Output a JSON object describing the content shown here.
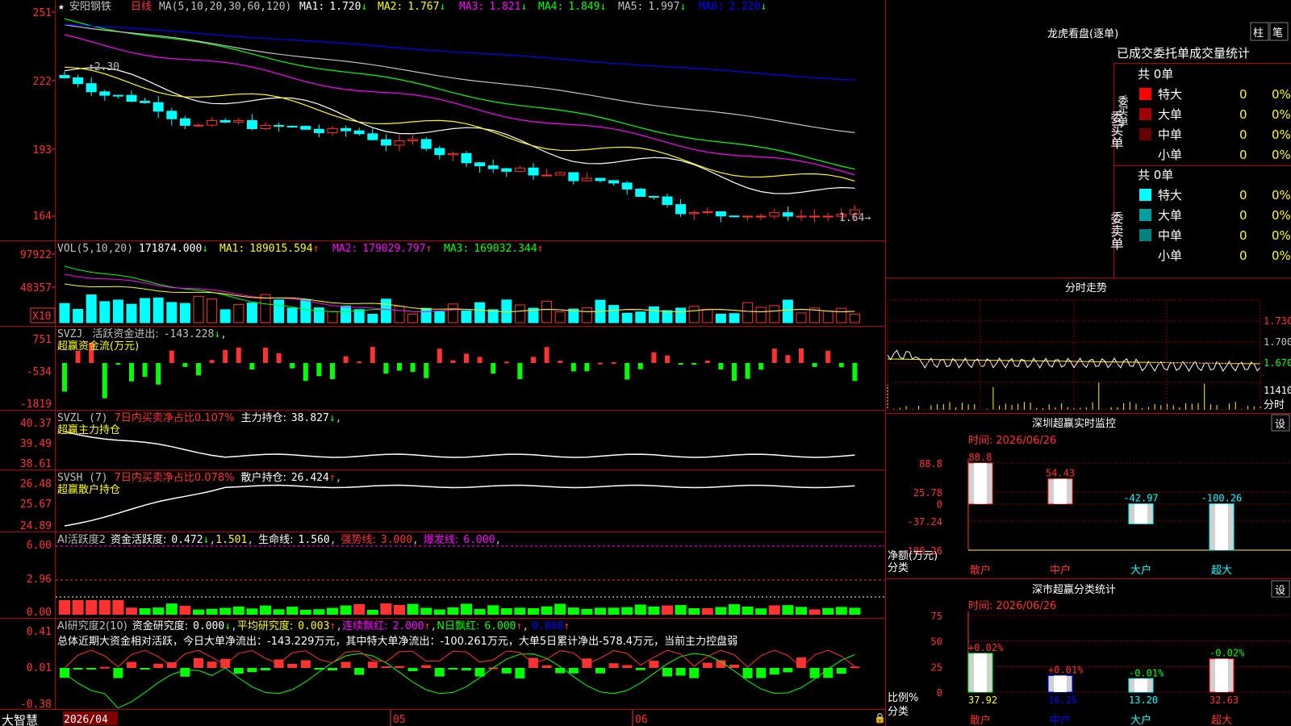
{
  "colors": {
    "up": "#ff3232",
    "down": "#00ffff",
    "flow_down": "#00ff00",
    "axis": "#ff3232",
    "ma1": "#ffffff",
    "ma2": "#ffff00",
    "ma3": "#ff00ff",
    "ma4": "#00ff00",
    "ma5": "#c0c0c0",
    "ma6": "#0000ff"
  },
  "main": {
    "star": "★",
    "stock": "安阳钢铁",
    "period": "日线",
    "ma_title": "MA(5,10,20,30,60,120)",
    "ma": [
      {
        "label": "MA1:",
        "value": "1.720",
        "arrow": "↓"
      },
      {
        "label": "MA2:",
        "value": "1.767",
        "arrow": "↓"
      },
      {
        "label": "MA3:",
        "value": "1.821",
        "arrow": "↓"
      },
      {
        "label": "MA4:",
        "value": "1.849",
        "arrow": "↓"
      },
      {
        "label": "MA5:",
        "value": "1.997",
        "arrow": "↓"
      },
      {
        "label": "MA6:",
        "value": "2.220",
        "arrow": "↓"
      }
    ],
    "yaxis": [
      "251",
      "222",
      "193",
      "164"
    ],
    "high_label": "2.30",
    "low_label": "1.64"
  },
  "vol": {
    "title": "VOL(5,10,20)",
    "value": "171874.000",
    "value_arrow": "↓",
    "ma": [
      {
        "label": "MA1:",
        "value": "189015.594",
        "arrow": "↑"
      },
      {
        "label": "MA2:",
        "value": "179029.797",
        "arrow": "↑"
      },
      {
        "label": "MA3:",
        "value": "169032.344",
        "arrow": "↑"
      }
    ],
    "yaxis": [
      "97922",
      "48357"
    ],
    "unit": "X10"
  },
  "svzj": {
    "title": "SVZJ",
    "label": "活跃资金进出:",
    "value": "-143.228",
    "arrow": "↓",
    "sub": "超赢资金流(万元)",
    "yaxis": [
      "751",
      "-534",
      "-1819"
    ]
  },
  "svzl": {
    "title": "SVZL (7)",
    "desc": "7日内买卖净占比0.107%",
    "label": "主力持仓:",
    "value": "38.827",
    "arrow": "↓",
    "sub": "超赢主力持仓",
    "yaxis": [
      "40.37",
      "39.49",
      "38.61"
    ]
  },
  "svsh": {
    "title": "SVSH (7)",
    "desc": "7日内买卖净占比0.078%",
    "label": "散户持仓:",
    "value": "26.424",
    "arrow": "↑",
    "sub": "超赢散户持仓",
    "yaxis": [
      "26.48",
      "25.67",
      "24.89"
    ]
  },
  "ai_active": {
    "title": "AI活跃度2",
    "label": "资金活跃度:",
    "value": "0.472",
    "arrow": "↓",
    "v2": "1.501",
    "life_label": "生命线:",
    "life": "1.560",
    "strong_label": "强势线:",
    "strong": "3.000",
    "burst_label": "爆发线:",
    "burst": "6.000",
    "yaxis": [
      "6.00",
      "2.96",
      "0.00"
    ]
  },
  "ai_research": {
    "title": "AI研究度2(10)",
    "label": "资金研究度:",
    "value": "0.000",
    "arrow": "↓",
    "avg_label": "平均研究度:",
    "avg": "0.003",
    "avg_arrow": "↑",
    "red_label": "连续飘红:",
    "red": "2.000",
    "red_arrow": "↑",
    "nred_label": "N日飘红:",
    "nred": "6.000",
    "nred_arrow": "↑",
    "blue": "0.008",
    "blue_arrow": "↑",
    "summary": "总体近期大资金相对活跃，今日大单净流出：-143.229万元，其中特大单净流出：-100.261万元，大单5日累计净出-578.4万元，当前主力控盘弱",
    "yaxis": [
      "0.41",
      "0.01",
      "-0.38"
    ]
  },
  "bottom": {
    "app": "大智慧",
    "date": "2026/04",
    "m05": "05",
    "m06": "06"
  },
  "right": {
    "lhb_title": "龙虎看盘(逐单)",
    "btn_zhu": "柱",
    "btn_bi": "笔",
    "stats_title": "已成交委托单成交量统计",
    "buy": {
      "side": "委买单",
      "total": "共 0单",
      "rows": [
        {
          "name": "特大",
          "count": "0",
          "pct": "0%",
          "color": "#ff0000"
        },
        {
          "name": "大单",
          "count": "0",
          "pct": "0%",
          "color": "#a00000"
        },
        {
          "name": "中单",
          "count": "0",
          "pct": "0%",
          "color": "#640000"
        },
        {
          "name": "小单",
          "count": "0",
          "pct": "0%",
          "color": ""
        }
      ]
    },
    "sell": {
      "side": "委卖单",
      "total": "共 0单",
      "rows": [
        {
          "name": "特大",
          "count": "0",
          "pct": "0%",
          "color": "#00ffff"
        },
        {
          "name": "大单",
          "count": "0",
          "pct": "0%",
          "color": "#00a0a0"
        },
        {
          "name": "中单",
          "count": "0",
          "pct": "0%",
          "color": "#008080"
        },
        {
          "name": "小单",
          "count": "0",
          "pct": "0%",
          "color": ""
        }
      ]
    },
    "intraday": {
      "title": "分时走势",
      "prices": [
        "1.730",
        "1.700",
        "1.670"
      ],
      "vol": "11410",
      "label": "分时"
    },
    "monitor": {
      "title": "深圳超赢实时监控",
      "settings": "设",
      "time_label": "时间:",
      "time": "2026/06/26",
      "yaxis": [
        "88.8",
        "25.78",
        "0",
        "-37.24",
        "-100.26"
      ],
      "ylabel": "净额(万元)",
      "xlabel": "分类",
      "categories": [
        "散户",
        "中户",
        "大户",
        "超大"
      ],
      "values": [
        "88.8",
        "54.43",
        "-42.97",
        "-100.26"
      ]
    },
    "classify": {
      "title": "深市超赢分类统计",
      "settings": "设",
      "time_label": "时间:",
      "time": "2026/06/26",
      "yaxis": [
        "75",
        "50",
        "25",
        "0"
      ],
      "ylabel": "比例%",
      "xlabel": "分类",
      "categories": [
        "散户",
        "中户",
        "大户",
        "超大"
      ],
      "pct_labels": [
        "+0.02%",
        "+0.01%",
        "-0.01%",
        "-0.02%"
      ],
      "values": [
        "37.92",
        "16.25",
        "13.20",
        "32.63"
      ]
    }
  },
  "chart_data": {
    "type": "bar",
    "title": "深圳超赢实时监控",
    "ylabel": "净额(万元)",
    "categories": [
      "散户",
      "中户",
      "大户",
      "超大"
    ],
    "values": [
      88.8,
      54.43,
      -42.97,
      -100.26
    ],
    "ylim": [
      -100.26,
      88.8
    ]
  }
}
